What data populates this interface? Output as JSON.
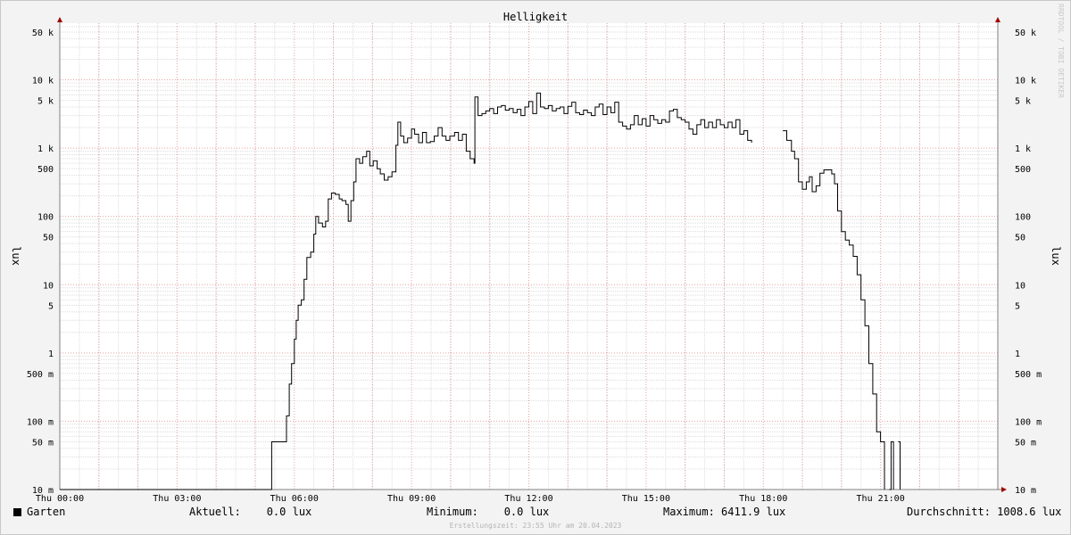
{
  "chart_data": {
    "type": "line",
    "title": "Helligkeit",
    "ylabel": "lux",
    "y_scale": "log",
    "ylim": [
      0.01,
      100000
    ],
    "x_range_hours": [
      0,
      24
    ],
    "x_ticks": [
      {
        "hour": 0,
        "label": "Thu 00:00"
      },
      {
        "hour": 3,
        "label": "Thu 03:00"
      },
      {
        "hour": 6,
        "label": "Thu 06:00"
      },
      {
        "hour": 9,
        "label": "Thu 09:00"
      },
      {
        "hour": 12,
        "label": "Thu 12:00"
      },
      {
        "hour": 15,
        "label": "Thu 15:00"
      },
      {
        "hour": 18,
        "label": "Thu 18:00"
      },
      {
        "hour": 21,
        "label": "Thu 21:00"
      }
    ],
    "y_ticks": [
      {
        "value": 0.01,
        "label": "10 m"
      },
      {
        "value": 0.05,
        "label": "50 m"
      },
      {
        "value": 0.1,
        "label": "100 m"
      },
      {
        "value": 0.5,
        "label": "500 m"
      },
      {
        "value": 1,
        "label": "1"
      },
      {
        "value": 5,
        "label": "5"
      },
      {
        "value": 10,
        "label": "10"
      },
      {
        "value": 50,
        "label": "50"
      },
      {
        "value": 100,
        "label": "100"
      },
      {
        "value": 500,
        "label": "500"
      },
      {
        "value": 1000,
        "label": "1 k"
      },
      {
        "value": 5000,
        "label": "5 k"
      },
      {
        "value": 10000,
        "label": "10 k"
      },
      {
        "value": 50000,
        "label": "50 k"
      }
    ],
    "grid": true,
    "series": [
      {
        "name": "Garten",
        "color": "#000000",
        "segments": [
          [
            [
              0,
              0.01
            ],
            [
              5.4,
              0.01
            ],
            [
              5.42,
              0.05
            ],
            [
              5.75,
              0.05
            ],
            [
              5.8,
              0.12
            ],
            [
              5.87,
              0.35
            ],
            [
              5.93,
              0.7
            ],
            [
              6.0,
              1.6
            ],
            [
              6.05,
              3
            ],
            [
              6.1,
              5
            ],
            [
              6.18,
              6
            ],
            [
              6.25,
              12
            ],
            [
              6.32,
              25
            ],
            [
              6.42,
              30
            ],
            [
              6.5,
              55
            ],
            [
              6.55,
              100
            ],
            [
              6.62,
              80
            ],
            [
              6.72,
              70
            ],
            [
              6.8,
              85
            ],
            [
              6.87,
              180
            ],
            [
              6.95,
              220
            ],
            [
              7.05,
              210
            ],
            [
              7.15,
              180
            ],
            [
              7.22,
              170
            ],
            [
              7.32,
              150
            ],
            [
              7.38,
              85
            ],
            [
              7.45,
              170
            ],
            [
              7.52,
              320
            ],
            [
              7.58,
              700
            ],
            [
              7.67,
              600
            ],
            [
              7.75,
              750
            ],
            [
              7.85,
              900
            ],
            [
              7.93,
              550
            ],
            [
              8.02,
              650
            ],
            [
              8.12,
              500
            ],
            [
              8.2,
              420
            ],
            [
              8.3,
              340
            ],
            [
              8.4,
              380
            ],
            [
              8.5,
              450
            ],
            [
              8.6,
              1100
            ],
            [
              8.65,
              2400
            ],
            [
              8.72,
              1500
            ],
            [
              8.8,
              1200
            ],
            [
              8.9,
              1400
            ],
            [
              9.0,
              1900
            ],
            [
              9.08,
              1600
            ],
            [
              9.18,
              1200
            ],
            [
              9.28,
              1700
            ],
            [
              9.38,
              1200
            ],
            [
              9.48,
              1250
            ],
            [
              9.58,
              1500
            ],
            [
              9.68,
              2000
            ],
            [
              9.78,
              1500
            ],
            [
              9.88,
              1300
            ],
            [
              9.98,
              1500
            ],
            [
              10.1,
              1700
            ],
            [
              10.2,
              1300
            ],
            [
              10.3,
              1600
            ],
            [
              10.4,
              900
            ],
            [
              10.5,
              700
            ],
            [
              10.6,
              600
            ],
            [
              10.62,
              5600
            ],
            [
              10.7,
              3000
            ],
            [
              10.8,
              3200
            ],
            [
              10.9,
              3500
            ],
            [
              11.0,
              3800
            ],
            [
              11.1,
              3200
            ],
            [
              11.2,
              4000
            ],
            [
              11.3,
              4200
            ],
            [
              11.4,
              3600
            ],
            [
              11.5,
              3800
            ],
            [
              11.6,
              3300
            ],
            [
              11.7,
              3700
            ],
            [
              11.8,
              3000
            ],
            [
              11.9,
              4000
            ],
            [
              12.0,
              4800
            ],
            [
              12.1,
              3200
            ],
            [
              12.2,
              6400
            ],
            [
              12.3,
              4000
            ],
            [
              12.4,
              3800
            ],
            [
              12.5,
              4200
            ],
            [
              12.6,
              3500
            ],
            [
              12.7,
              3800
            ],
            [
              12.8,
              4000
            ],
            [
              12.9,
              3200
            ],
            [
              13.0,
              4100
            ],
            [
              13.1,
              4700
            ],
            [
              13.2,
              3300
            ],
            [
              13.3,
              3100
            ],
            [
              13.4,
              3600
            ],
            [
              13.5,
              3300
            ],
            [
              13.6,
              3000
            ],
            [
              13.7,
              4000
            ],
            [
              13.8,
              4400
            ],
            [
              13.9,
              3100
            ],
            [
              14.0,
              4000
            ],
            [
              14.1,
              3300
            ],
            [
              14.2,
              4700
            ],
            [
              14.3,
              2400
            ],
            [
              14.4,
              2100
            ],
            [
              14.5,
              1900
            ],
            [
              14.6,
              2200
            ],
            [
              14.7,
              3000
            ],
            [
              14.8,
              2200
            ],
            [
              14.9,
              2700
            ],
            [
              15.0,
              2100
            ],
            [
              15.1,
              3000
            ],
            [
              15.2,
              2600
            ],
            [
              15.3,
              2300
            ],
            [
              15.4,
              2600
            ],
            [
              15.5,
              2400
            ],
            [
              15.6,
              3500
            ],
            [
              15.7,
              3700
            ],
            [
              15.8,
              2800
            ],
            [
              15.9,
              2600
            ],
            [
              16.0,
              2400
            ],
            [
              16.1,
              1900
            ],
            [
              16.2,
              1600
            ],
            [
              16.3,
              2200
            ],
            [
              16.4,
              2600
            ],
            [
              16.5,
              2000
            ],
            [
              16.6,
              2400
            ],
            [
              16.7,
              2000
            ],
            [
              16.8,
              2600
            ],
            [
              16.9,
              2200
            ],
            [
              17.0,
              2000
            ],
            [
              17.1,
              2400
            ],
            [
              17.2,
              2000
            ],
            [
              17.3,
              2600
            ],
            [
              17.4,
              1600
            ],
            [
              17.5,
              1800
            ],
            [
              17.6,
              1300
            ],
            [
              17.7,
              1200
            ]
          ],
          [
            [
              18.5,
              1800
            ],
            [
              18.6,
              1300
            ],
            [
              18.72,
              900
            ],
            [
              18.8,
              700
            ],
            [
              18.9,
              320
            ],
            [
              19.0,
              250
            ],
            [
              19.1,
              320
            ],
            [
              19.18,
              380
            ],
            [
              19.25,
              230
            ],
            [
              19.35,
              280
            ],
            [
              19.45,
              430
            ],
            [
              19.55,
              480
            ],
            [
              19.65,
              480
            ],
            [
              19.75,
              420
            ],
            [
              19.82,
              300
            ],
            [
              19.9,
              120
            ],
            [
              20.0,
              60
            ],
            [
              20.1,
              45
            ],
            [
              20.2,
              38
            ],
            [
              20.3,
              26
            ],
            [
              20.4,
              14
            ],
            [
              20.5,
              6
            ],
            [
              20.6,
              2.5
            ],
            [
              20.7,
              0.7
            ],
            [
              20.8,
              0.25
            ],
            [
              20.9,
              0.07
            ],
            [
              21.0,
              0.05
            ],
            [
              21.1,
              0.01
            ]
          ],
          [
            [
              21.22,
              0.01
            ],
            [
              21.27,
              0.05
            ],
            [
              21.33,
              0.01
            ]
          ],
          [
            [
              21.45,
              0.05
            ],
            [
              21.5,
              0.01
            ]
          ]
        ]
      }
    ]
  },
  "footer": {
    "legend_label": "Garten",
    "current": "Aktuell:    0.0 lux",
    "minimum": "Minimum:    0.0 lux",
    "maximum": "Maximum: 6411.9 lux",
    "average": "Durchschnitt: 1008.6 lux",
    "created": "Erstellungszeit: 23:55 Uhr am 20.04.2023"
  },
  "vendor_text": "RRDTOOL / TOBI OETIKER",
  "colors": {
    "background": "#f3f3f3",
    "canvas": "#ffffff",
    "grid_minor": "#dcdcdc",
    "grid_major": "#e6a0a0",
    "axis": "#808080",
    "arrow": "#a00000"
  }
}
